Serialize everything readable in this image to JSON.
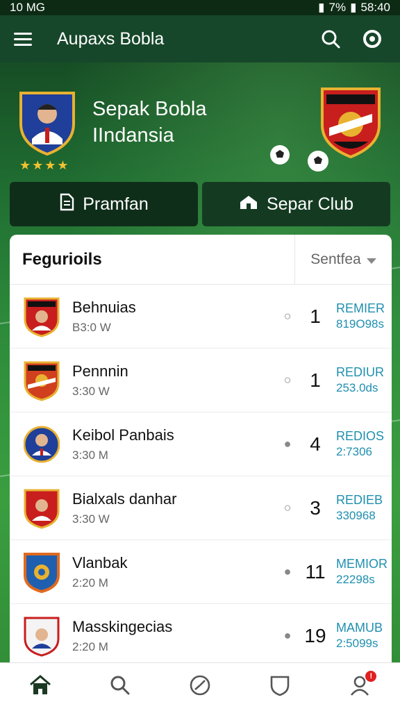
{
  "status_bar": {
    "left": "10 MG",
    "battery": "7%",
    "time": "58:40"
  },
  "app": {
    "title": "Aupaxs Bobla"
  },
  "hero": {
    "title_line1": "Sepak Bobla",
    "title_line2": "IIndansia",
    "stars": "★★★★"
  },
  "tabs": [
    {
      "label": "Pramfan",
      "active": true
    },
    {
      "label": "Separ Club",
      "active": false
    }
  ],
  "list": {
    "heading": "Fegurioils",
    "filter_label": "Sentfea",
    "rows": [
      {
        "name": "Behnuias",
        "time": "B3:0  W",
        "dot": "○",
        "number": "1",
        "label": "REMIER",
        "value": "819O98s"
      },
      {
        "name": "Pennnin",
        "time": "3:30  W",
        "dot": "○",
        "number": "1",
        "label": "REDIUR",
        "value": "253.0ds"
      },
      {
        "name": "Keibol Panbais",
        "time": "3:30  M",
        "dot": "●",
        "number": "4",
        "label": "REDIOS",
        "value": "2:7306"
      },
      {
        "name": "Bialxals danhar",
        "time": "3:30  W",
        "dot": "○",
        "number": "3",
        "label": "REDIEB",
        "value": "330968"
      },
      {
        "name": "Vlanbak",
        "time": "2:20  M",
        "dot": "●",
        "number": "11",
        "label": "MEMIOR",
        "value": "22298s"
      },
      {
        "name": "Masskingecias",
        "time": "2:20  M",
        "dot": "●",
        "number": "19",
        "label": "MAMUB",
        "value": "2:5099s"
      }
    ]
  },
  "bottom_nav": {
    "badge": "!"
  },
  "colors": {
    "accent_teal": "#1f8fb0",
    "header_green": "#17472a",
    "star_gold": "#f2c230"
  }
}
